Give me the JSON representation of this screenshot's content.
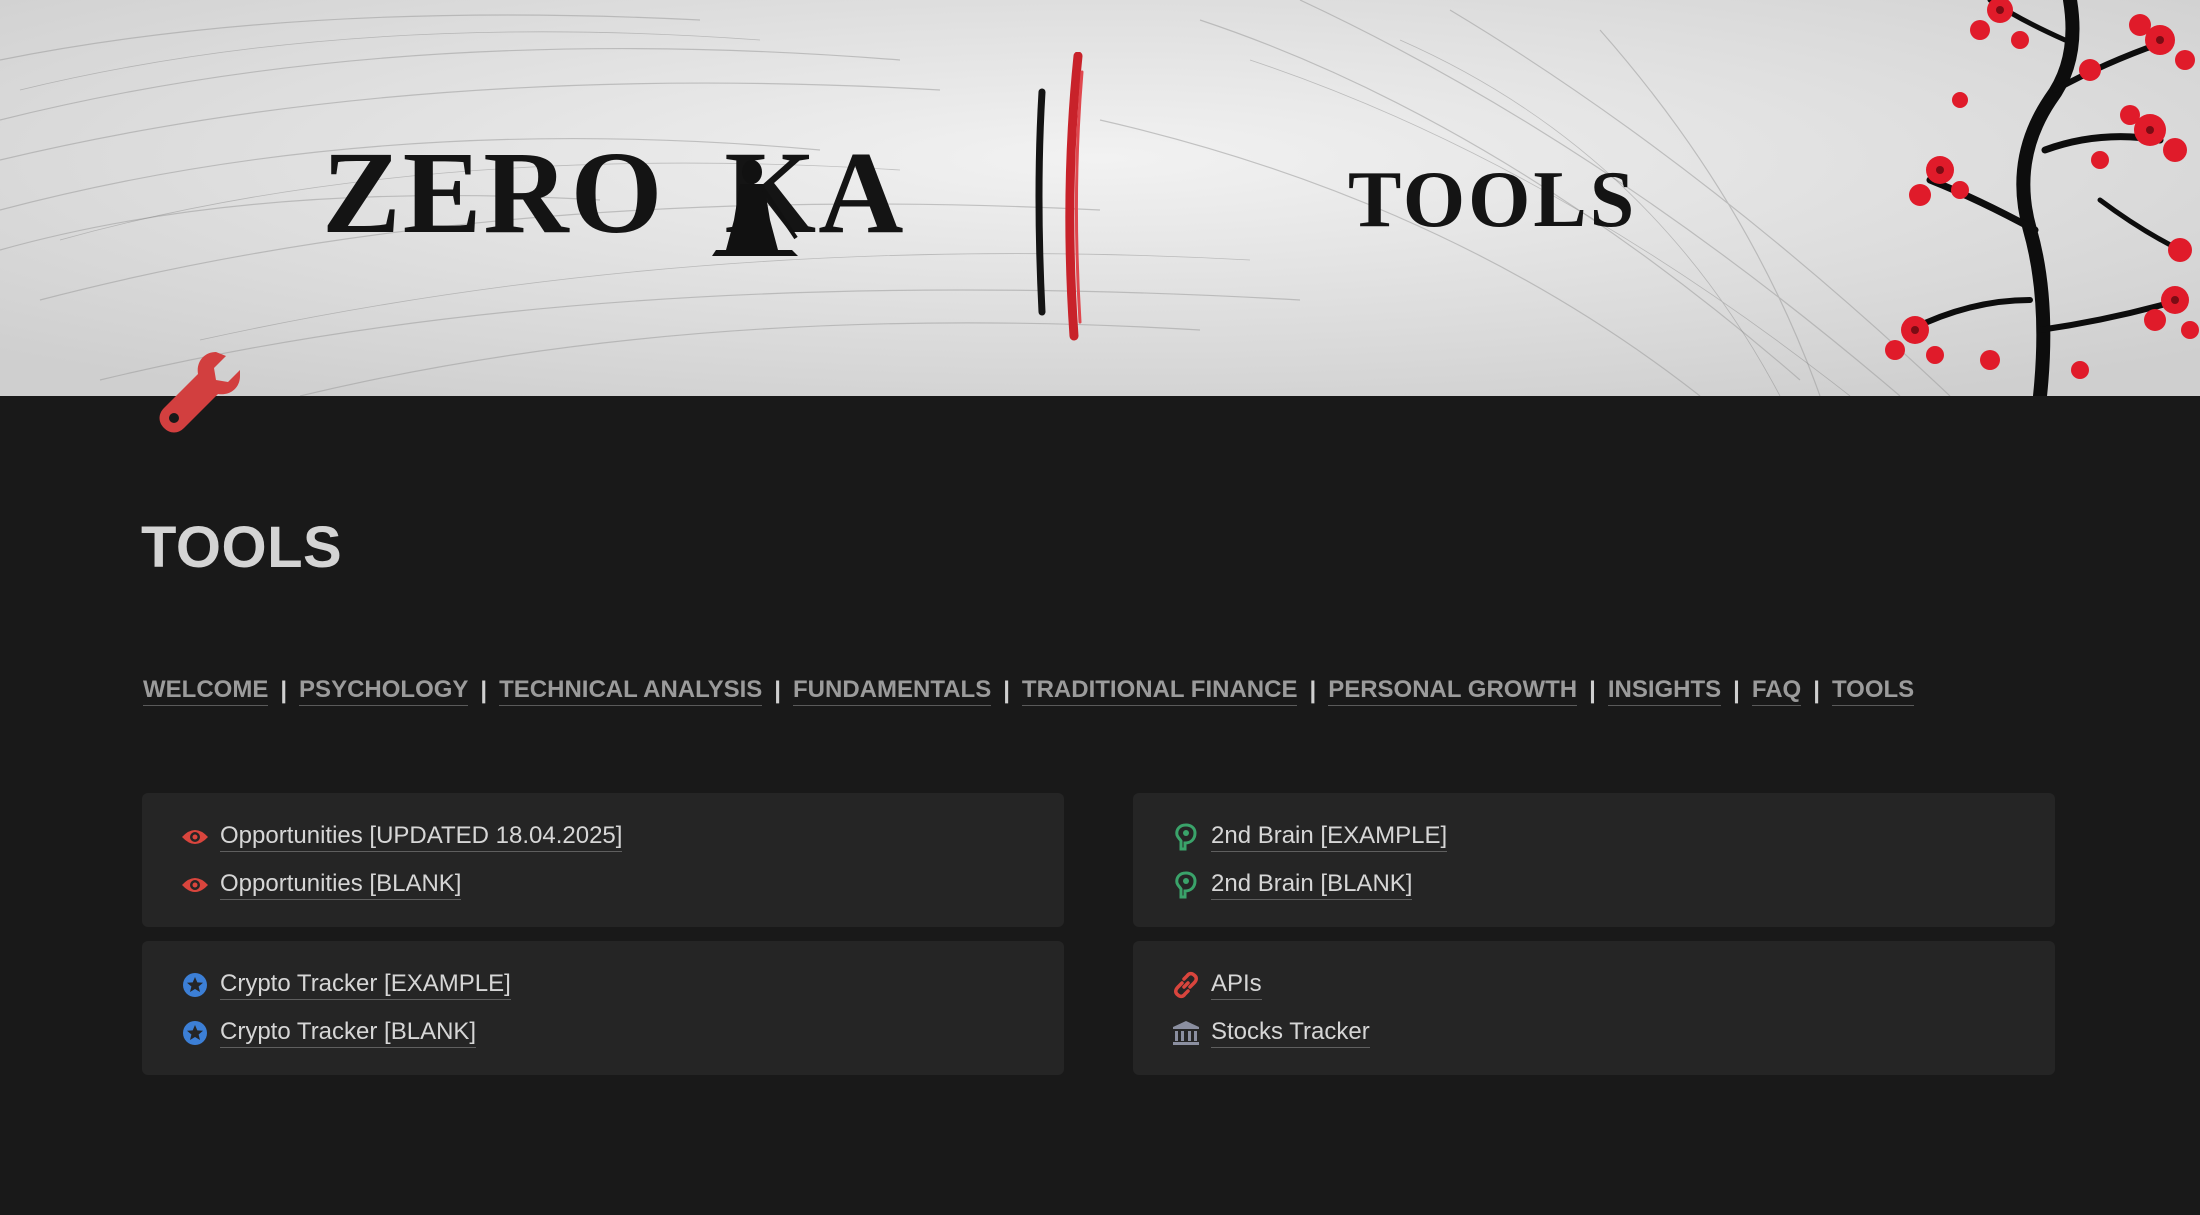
{
  "cover": {
    "brand_left": "ZERO",
    "brand_right": "KA",
    "title": "TOOLS"
  },
  "page": {
    "icon": "wrench-icon",
    "title": "TOOLS"
  },
  "nav": {
    "separator": "|",
    "links": [
      "WELCOME",
      "PSYCHOLOGY",
      "TECHNICAL ANALYSIS",
      "FUNDAMENTALS",
      "TRADITIONAL FINANCE",
      "PERSONAL GROWTH",
      "INSIGHTS",
      "FAQ",
      "TOOLS"
    ]
  },
  "cards": {
    "opportunities": {
      "icon": "eye-icon",
      "icon_color": "#d9453d",
      "items": [
        "Opportunities [UPDATED 18.04.2025]",
        "Opportunities [BLANK]"
      ]
    },
    "brain": {
      "icon": "brain-head-icon",
      "icon_color": "#3aa36a",
      "items": [
        "2nd Brain [EXAMPLE]",
        "2nd Brain [BLANK]"
      ]
    },
    "crypto": {
      "icon": "star-badge-icon",
      "icon_color": "#3c7fd6",
      "items": [
        "Crypto Tracker [EXAMPLE]",
        "Crypto Tracker [BLANK]"
      ]
    },
    "apis_stocks": {
      "items": [
        {
          "label": "APIs",
          "icon": "link-icon",
          "icon_color": "#d9453d"
        },
        {
          "label": "Stocks Tracker",
          "icon": "bank-icon",
          "icon_color": "#8b8fa0"
        }
      ]
    }
  },
  "colors": {
    "background": "#191919",
    "card": "#252525",
    "text": "#d6d6d6",
    "nav_text": "#9b9b9b",
    "accent_red": "#d43c3c"
  }
}
